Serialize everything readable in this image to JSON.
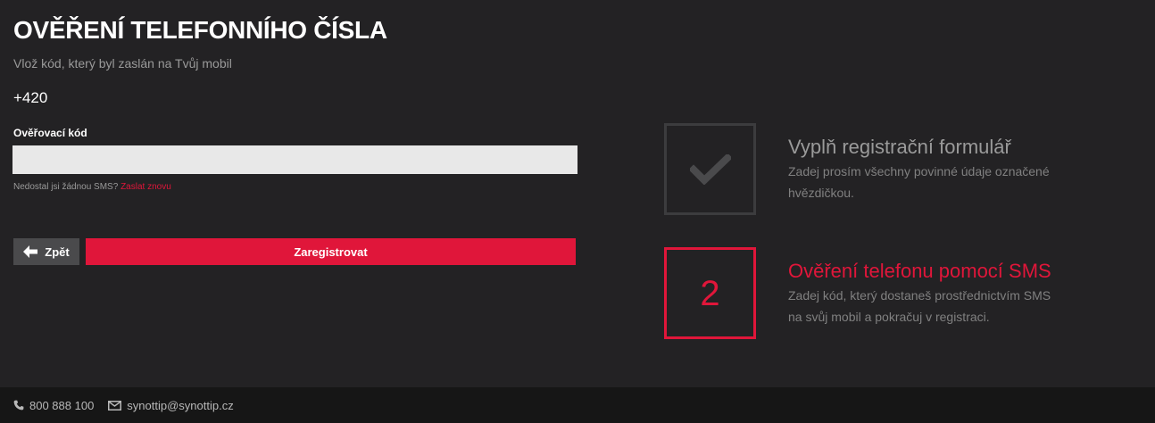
{
  "header": {
    "title": "OVĚŘENÍ TELEFONNÍHO ČÍSLA",
    "subtitle": "Vlož kód, který byl zaslán na Tvůj mobil",
    "phone_prefix": "+420"
  },
  "form": {
    "code_label": "Ověřovací kód",
    "code_value": "",
    "resend_text": "Nedostal jsi žádnou SMS?",
    "resend_link": "Zaslat znovu",
    "back_label": "Zpět",
    "submit_label": "Zaregistrovat"
  },
  "steps": [
    {
      "title": "Vyplň registrační formulář",
      "description": "Zadej prosím všechny povinné údaje označené hvězdičkou.",
      "status": "done",
      "icon": "check-icon"
    },
    {
      "number": "2",
      "title": "Ověření telefonu pomocí SMS",
      "description": "Zadej kód, který dostaneš prostřednictvím SMS na svůj mobil a pokračuj v registraci.",
      "status": "active"
    }
  ],
  "footer": {
    "phone": "800 888 100",
    "email": "synottip@synottip.cz"
  },
  "colors": {
    "accent": "#e0163a",
    "background": "#232224",
    "footer_background": "#161616",
    "input_background": "#e8e8e8",
    "back_button": "#4a4a4c",
    "muted_text": "#9a9a9a"
  }
}
